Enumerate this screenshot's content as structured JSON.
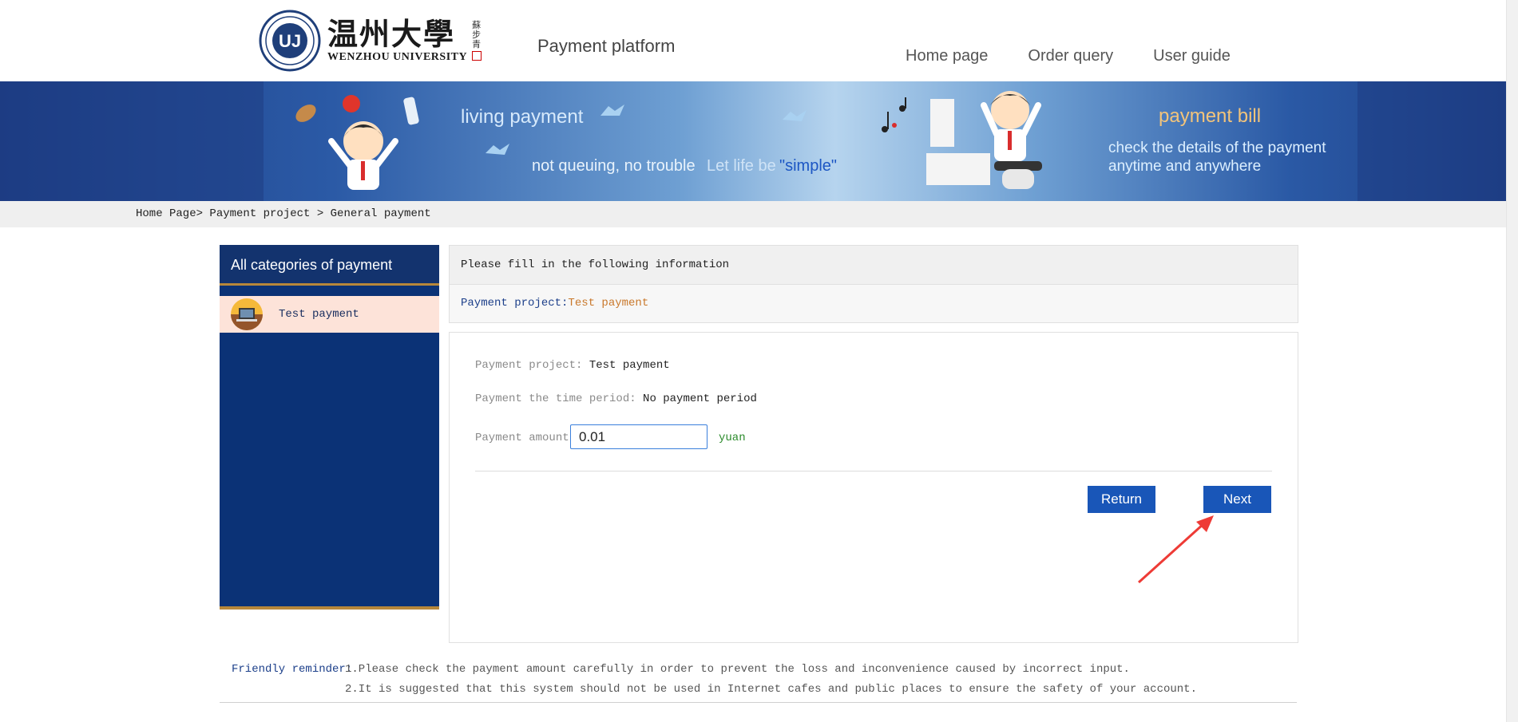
{
  "header": {
    "logo_cn": "温州大學",
    "logo_en": "WENZHOU UNIVERSITY",
    "logo_side": "蘇步青",
    "platform_title": "Payment platform",
    "nav": [
      "Home page",
      "Order query",
      "User guide"
    ]
  },
  "banner": {
    "living": "living payment",
    "queue": "not queuing, no trouble",
    "life": "Let life be",
    "simple": "\"simple\"",
    "bill": "payment bill",
    "check_line1": "check the details of the payment",
    "check_line2": "anytime and anywhere"
  },
  "breadcrumb": "Home Page> Payment project > General payment",
  "sidebar": {
    "title": "All categories of payment",
    "items": [
      {
        "label": "Test payment",
        "icon": "laptop-icon"
      }
    ]
  },
  "info": {
    "heading": "Please fill in the following information",
    "project_label": "Payment project:",
    "project_value": "Test payment"
  },
  "form": {
    "project_label": "Payment project:",
    "project_value": "Test payment",
    "period_label": "Payment the time period:",
    "period_value": "No payment period",
    "amount_label": "Payment amount:",
    "amount_value": "0.01",
    "unit": "yuan",
    "return_label": "Return",
    "next_label": "Next"
  },
  "reminder": {
    "label": "Friendly reminder:",
    "line1": "1.Please check the payment amount carefully in order to prevent the loss and inconvenience caused by incorrect input.",
    "line2": "2.It is suggested that this system should not be used in Internet cafes and public places to ensure the safety of your account."
  },
  "colors": {
    "sidebar_bg": "#0b3276",
    "button": "#1956b8",
    "accent_orange": "#c9782b",
    "annotation_arrow": "#ee3b36"
  }
}
